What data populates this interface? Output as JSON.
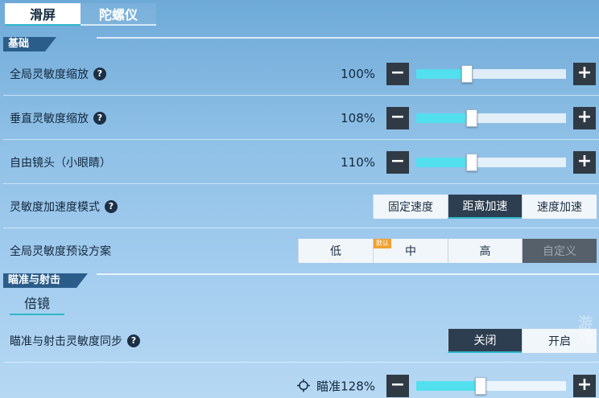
{
  "tabs": [
    {
      "label": "滑屏",
      "active": true
    },
    {
      "label": "陀螺仪",
      "active": false
    }
  ],
  "sections": {
    "basic": "基础",
    "aim": "瞄准与射击"
  },
  "rows": {
    "global_scale": {
      "label": "全局灵敏度缩放",
      "value_text": "100%",
      "value": 0.34
    },
    "vertical_scale": {
      "label": "垂直灵敏度缩放",
      "value_text": "108%",
      "value": 0.37
    },
    "free_cam": {
      "label": "自由镜头（小眼睛）",
      "value_text": "110%",
      "value": 0.37
    },
    "accel_mode": {
      "label": "灵敏度加速度模式",
      "options": [
        "固定速度",
        "距离加速",
        "速度加速"
      ],
      "selected": "距离加速"
    },
    "preset": {
      "label": "全局灵敏度预设方案",
      "options": [
        "低",
        "中",
        "高",
        "自定义"
      ],
      "badge": "默认",
      "selected": "自定义"
    },
    "sync": {
      "label": "瞄准与射击灵敏度同步",
      "options": [
        "关闭",
        "开启"
      ],
      "selected": "关闭"
    },
    "aim_scope": {
      "label": "瞄准128%",
      "value": 0.43
    }
  },
  "subtab": "倍镜",
  "help_icon": "?",
  "stepper": {
    "minus": "−",
    "plus": "+"
  },
  "watermark": "游戏"
}
